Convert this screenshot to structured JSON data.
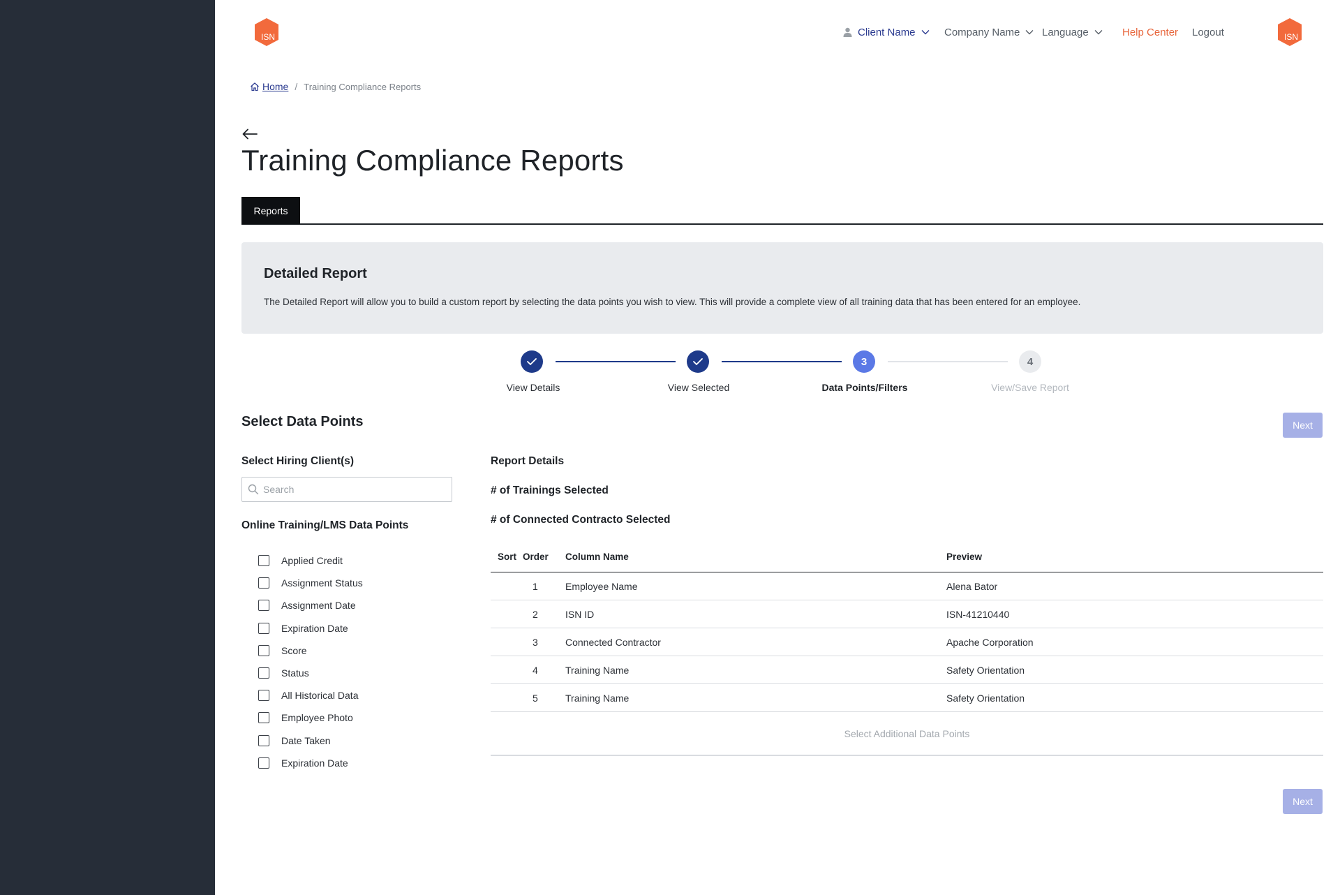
{
  "header": {
    "client_name": "Client Name",
    "company_name": "Company Name",
    "language": "Language",
    "help_center": "Help Center",
    "logout": "Logout",
    "logo_text": "ISN"
  },
  "breadcrumb": {
    "home": "Home",
    "separator": "/",
    "current": "Training Compliance Reports"
  },
  "page": {
    "title": "Training Compliance Reports"
  },
  "tabs": [
    {
      "label": "Reports",
      "active": true
    }
  ],
  "info": {
    "title": "Detailed Report",
    "description": "The Detailed Report will allow you to build a custom report by selecting the data points you wish to view. This will provide a complete view of all training data that has been entered for an employee."
  },
  "stepper": {
    "steps": [
      {
        "number": "1",
        "label": "View Details",
        "state": "complete"
      },
      {
        "number": "2",
        "label": "View Selected",
        "state": "complete"
      },
      {
        "number": "3",
        "label": "Data Points/Filters",
        "state": "current"
      },
      {
        "number": "4",
        "label": "View/Save Report",
        "state": "upcoming"
      }
    ]
  },
  "section": {
    "title": "Select Data Points",
    "next_label": "Next"
  },
  "hiring_clients": {
    "title": "Select Hiring Client(s)",
    "search_placeholder": "Search"
  },
  "lms": {
    "title": "Online Training/LMS Data Points",
    "items": [
      "Applied Credit",
      "Assignment Status",
      "Assignment Date",
      "Expiration Date",
      "Score",
      "Status",
      "All Historical Data",
      "Employee Photo",
      "Date Taken",
      "Expiration Date"
    ]
  },
  "report_details": {
    "title": "Report Details",
    "trainings_selected": "# of Trainings Selected",
    "contractors_selected": "# of Connected Contracto Selected",
    "columns": {
      "sort": "Sort",
      "order": "Order",
      "name": "Column Name",
      "preview": "Preview"
    },
    "rows": [
      {
        "order": "1",
        "name": "Employee Name",
        "preview": "Alena Bator"
      },
      {
        "order": "2",
        "name": "ISN ID",
        "preview": "ISN-41210440"
      },
      {
        "order": "3",
        "name": "Connected Contractor",
        "preview": "Apache Corporation"
      },
      {
        "order": "4",
        "name": "Training Name",
        "preview": "Safety Orientation"
      },
      {
        "order": "5",
        "name": "Training Name",
        "preview": "Safety Orientation"
      }
    ],
    "add_more": "Select Additional Data Points"
  },
  "colors": {
    "sidebar": "#262d38",
    "brand_orange": "#f26a3c",
    "primary_navy": "#1e3a8a",
    "step_current": "#5b79e6",
    "next_disabled": "#a6b0e6",
    "help_link": "#e8663c"
  }
}
